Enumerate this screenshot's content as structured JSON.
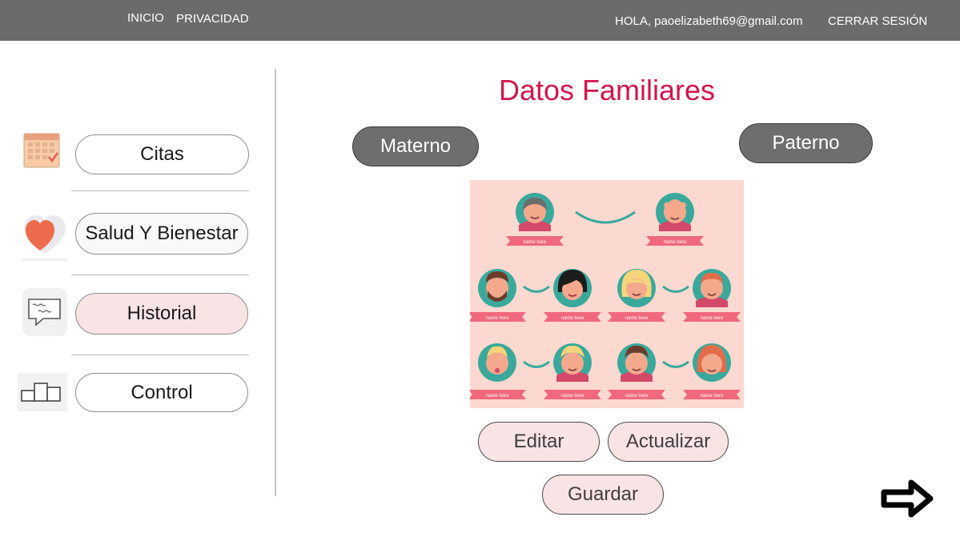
{
  "nav": {
    "home": "INICIO",
    "privacy": "PRIVACIDAD",
    "greeting": "HOLA, paoelizabeth69@gmail.com",
    "logout": "CERRAR SESIÓN"
  },
  "sidebar": {
    "items": [
      {
        "label": "Citas",
        "icon": "calendar-icon"
      },
      {
        "label": "Salud Y Bienestar",
        "icon": "heart-icon"
      },
      {
        "label": "Historial",
        "icon": "chat-bubble-icon"
      },
      {
        "label": "Control",
        "icon": "bar-chart-icon"
      }
    ]
  },
  "main": {
    "title": "Datos Familiares",
    "maternal_label": "Materno",
    "paternal_label": "Paterno",
    "edit_label": "Editar",
    "update_label": "Actualizar",
    "save_label": "Guardar",
    "tree_caption": "name here"
  },
  "colors": {
    "topbar": "#6b6b6b",
    "title": "#d3164d",
    "pink_button": "#f8e3e5",
    "dark_button": "#6e6e6e",
    "tree_background": "#fbd9d0",
    "ribbon": "#f0687d",
    "avatar_circle": "#3aa99c"
  }
}
